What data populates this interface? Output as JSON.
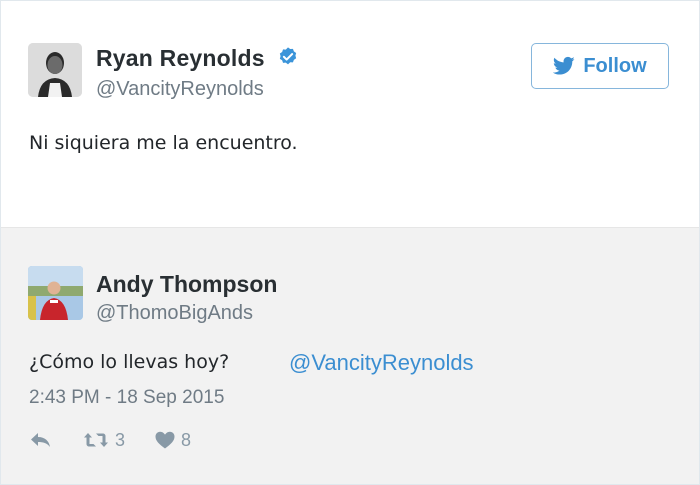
{
  "tweet": {
    "author_name": "Ryan Reynolds",
    "author_handle": "@VancityReynolds",
    "verified": true,
    "follow_label": "Follow",
    "text": "Ni siquiera me la encuentro."
  },
  "reply": {
    "author_name": "Andy Thompson",
    "author_handle": "@ThomoBigAnds",
    "text": "¿Cómo lo llevas hoy?",
    "mention": "@VancityReynolds",
    "timestamp": "2:43 PM - 18 Sep 2015",
    "retweets": "3",
    "likes": "8"
  },
  "colors": {
    "link_blue": "#3b8ed1",
    "muted_gray": "#8899a6",
    "reply_background": "#f2f2f2"
  },
  "icons": {
    "verified": "verified-badge-icon",
    "follow": "twitter-bird-icon",
    "reply": "reply-arrow-icon",
    "retweet": "retweet-icon",
    "like": "heart-icon"
  }
}
